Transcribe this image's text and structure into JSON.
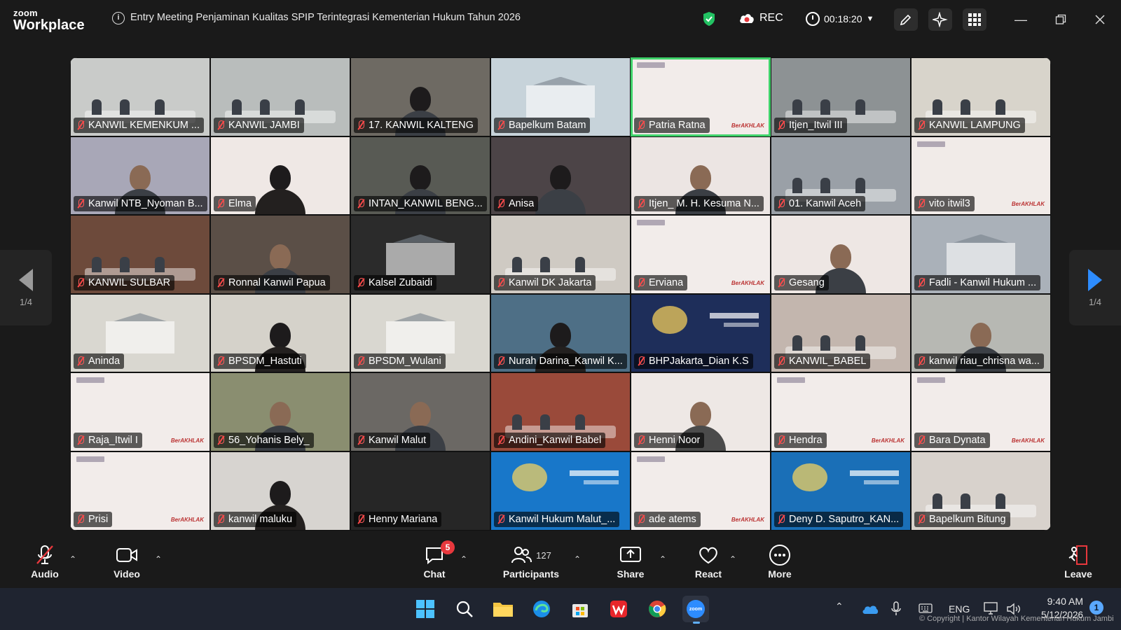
{
  "app": {
    "logo_top": "zoom",
    "logo_bottom": "Workplace",
    "meeting_title": "Entry Meeting Penjaminan Kualitas SPIP Terintegrasi Kementerian Hukum Tahun 2026",
    "rec_label": "REC",
    "timer": "00:18:20"
  },
  "pager": {
    "left_page": "1/4",
    "right_page": "1/4"
  },
  "participants": [
    {
      "name": "KANWIL KEMENKUM ...",
      "bg": "#c9cbc9",
      "style": "room"
    },
    {
      "name": "KANWIL JAMBI",
      "bg": "#b9bdbc",
      "style": "room"
    },
    {
      "name": "17. KANWIL KALTENG",
      "bg": "#6e6a63",
      "style": "person-dark"
    },
    {
      "name": "Bapelkum Batam",
      "bg": "#c7d3da",
      "style": "building"
    },
    {
      "name": "Patria Ratna",
      "bg": "#f2ecea",
      "style": "slide",
      "active": true
    },
    {
      "name": "Itjen_Itwil III",
      "bg": "#8d9294",
      "style": "room"
    },
    {
      "name": "KANWIL LAMPUNG",
      "bg": "#d8d4cb",
      "style": "room"
    },
    {
      "name": "Kanwil NTB_Nyoman B...",
      "bg": "#a8a7b7",
      "style": "person"
    },
    {
      "name": "Elma",
      "bg": "#efe8e5",
      "style": "person-hijab"
    },
    {
      "name": "INTAN_KANWIL BENG...",
      "bg": "#585a54",
      "style": "person-dark"
    },
    {
      "name": "Anisa",
      "bg": "#4c4447",
      "style": "person-dark"
    },
    {
      "name": "Itjen_ M. H. Kesuma N...",
      "bg": "#ece5e3",
      "style": "person"
    },
    {
      "name": "01. Kanwil Aceh",
      "bg": "#9aa0a7",
      "style": "room"
    },
    {
      "name": "vito itwil3",
      "bg": "#f1ebe8",
      "style": "slide"
    },
    {
      "name": "KANWIL SULBAR",
      "bg": "#6d4a3b",
      "style": "room"
    },
    {
      "name": "Ronnal Kanwil Papua",
      "bg": "#5b4f47",
      "style": "person"
    },
    {
      "name": "Kalsel Zubaidi",
      "bg": "#2b2b2b",
      "style": "building"
    },
    {
      "name": "Kanwil DK Jakarta",
      "bg": "#cfcac3",
      "style": "room"
    },
    {
      "name": "Erviana",
      "bg": "#f2ecea",
      "style": "slide"
    },
    {
      "name": "Gesang",
      "bg": "#eee7e4",
      "style": "person"
    },
    {
      "name": "Fadli - Kanwil Hukum ...",
      "bg": "#aab1b9",
      "style": "building"
    },
    {
      "name": "Aninda",
      "bg": "#d9d7d0",
      "style": "building"
    },
    {
      "name": "BPSDM_Hastuti",
      "bg": "#d5d2ca",
      "style": "person-hijab"
    },
    {
      "name": "BPSDM_Wulani",
      "bg": "#d9d7d0",
      "style": "building"
    },
    {
      "name": "Nurah Darina_Kanwil K...",
      "bg": "#4e6f86",
      "style": "person-hijab"
    },
    {
      "name": "BHPJakarta_Dian K.S",
      "bg": "#1e2e5a",
      "style": "banner"
    },
    {
      "name": "KANWIL_BABEL",
      "bg": "#c3b6ae",
      "style": "room"
    },
    {
      "name": "kanwil riau_chrisna wa...",
      "bg": "#b7b8b3",
      "style": "person"
    },
    {
      "name": "Raja_Itwil I",
      "bg": "#f2ecea",
      "style": "slide"
    },
    {
      "name": "56_Yohanis Bely_",
      "bg": "#8a8e70",
      "style": "person"
    },
    {
      "name": "Kanwil Malut",
      "bg": "#6b6864",
      "style": "person"
    },
    {
      "name": "Andini_Kanwil Babel",
      "bg": "#9a4a3a",
      "style": "room"
    },
    {
      "name": "Henni Noor",
      "bg": "#eee8e5",
      "style": "avatar"
    },
    {
      "name": "Hendra",
      "bg": "#f2ecea",
      "style": "slide"
    },
    {
      "name": "Bara Dynata",
      "bg": "#f2ecea",
      "style": "slide"
    },
    {
      "name": "Prisi",
      "bg": "#f2ecea",
      "style": "slide"
    },
    {
      "name": "kanwil maluku",
      "bg": "#d7d4d0",
      "style": "person-hijab"
    },
    {
      "name": "Henny Mariana",
      "bg": "#262626",
      "style": "blank"
    },
    {
      "name": "Kanwil Hukum Malut_...",
      "bg": "#1877c9",
      "style": "banner"
    },
    {
      "name": "ade atems",
      "bg": "#f2ecea",
      "style": "slide"
    },
    {
      "name": "Deny D. Saputro_KAN...",
      "bg": "#1a6fb7",
      "style": "banner"
    },
    {
      "name": "Bapelkum Bitung",
      "bg": "#d8d2cc",
      "style": "room"
    }
  ],
  "toolbar": {
    "audio": "Audio",
    "video": "Video",
    "chat": "Chat",
    "chat_badge": "5",
    "participants": "Participants",
    "participants_count": "127",
    "share": "Share",
    "react": "React",
    "more": "More",
    "leave": "Leave"
  },
  "taskbar": {
    "lang": "ENG",
    "time": "9:40 AM",
    "date": "5/12/2026",
    "notifications": "1",
    "zoom_label": "zoom"
  },
  "watermark": "© Copyright | Kantor Wilayah Kementerian Hukum Jambi",
  "colors": {
    "accent_green": "#3fd26a",
    "pager_blue": "#2d8cff",
    "badge_red": "#e8383d"
  }
}
